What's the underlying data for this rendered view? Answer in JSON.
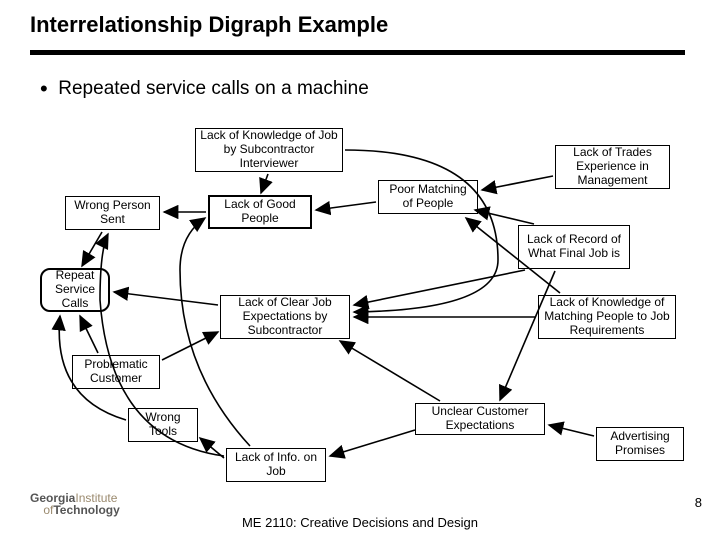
{
  "title": "Interrelationship Digraph Example",
  "bullet": "Repeated service calls on a machine",
  "nodes": {
    "lackKnowledge": "Lack of Knowledge of Job by Subcontractor Interviewer",
    "lackTrades": "Lack of Trades Experience in Management",
    "wrongPerson": "Wrong Person Sent",
    "lackGoodPeople": "Lack of Good People",
    "poorMatching": "Poor Matching of People",
    "lackRecord": "Lack of Record of What Final Job is",
    "repeatCalls": "Repeat Service Calls",
    "lackClearExp": "Lack of Clear Job Expectations by Subcontractor",
    "lackKnowMatch": "Lack of Knowledge of Matching People to Job Requirements",
    "problematic": "Problematic Customer",
    "wrongTools": "Wrong Tools",
    "unclearCust": "Unclear Customer Expectations",
    "lackInfo": "Lack of Info. on Job",
    "advertising": "Advertising Promises"
  },
  "footer": "ME 2110: Creative Decisions and Design",
  "page": "8",
  "logo": {
    "line1": "Georgia",
    "line2": "Institute",
    "line3": "of",
    "line4": "Technology"
  }
}
